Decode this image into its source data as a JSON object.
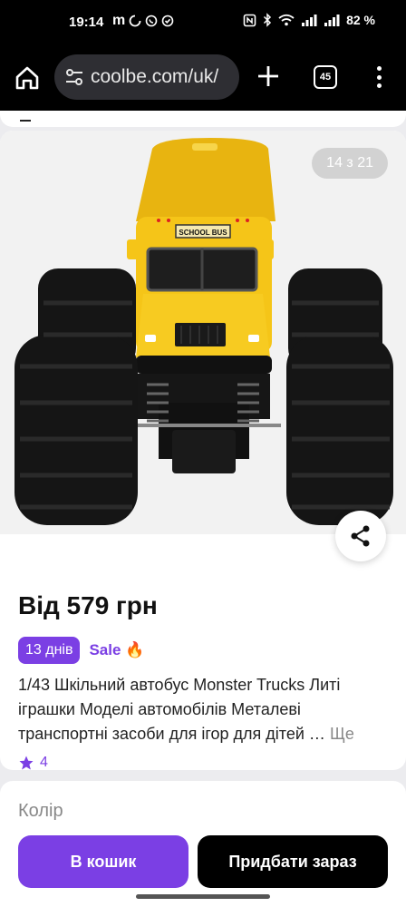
{
  "status_bar": {
    "time": "19:14",
    "left_icons": [
      "m-notification-icon",
      "sync-icon",
      "viber-icon",
      "check-icon"
    ],
    "battery": "82 %",
    "right_icons": [
      "nfc-icon",
      "bluetooth-icon",
      "wifi-icon",
      "signal-icon",
      "signal-icon"
    ]
  },
  "browser": {
    "url": "coolbe.com/uk/",
    "tabs_count": "45"
  },
  "gallery": {
    "counter": "14 з 21",
    "bus_sign": "SCHOOL BUS"
  },
  "product": {
    "price": "Від 579 грн",
    "days_badge": "13 днів",
    "sale_label": "Sale",
    "sale_emoji": "🔥",
    "title": "1/43 Шкільний автобус Monster Trucks Литі іграшки Моделі автомобілів Металеві транспортні засоби для ігор для дітей …",
    "more_label": "Ще",
    "rating": "4"
  },
  "options": {
    "color_label": "Колір"
  },
  "actions": {
    "cart_label": "В кошик",
    "buy_label": "Придбати зараз"
  },
  "colors": {
    "accent": "#7b3fe4",
    "bus_yellow": "#f5c518"
  }
}
